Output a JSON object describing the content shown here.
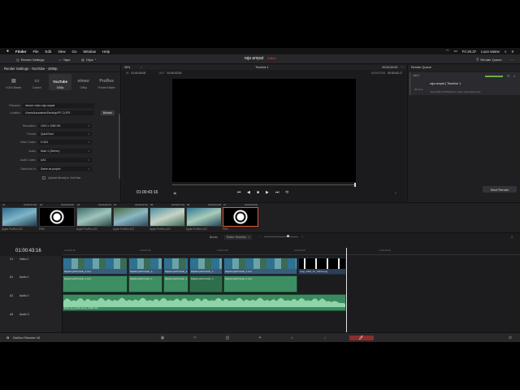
{
  "menubar": {
    "app": "Finder",
    "items": [
      "File",
      "Edit",
      "View",
      "Go",
      "Window",
      "Help"
    ],
    "clock": "Fri 20.37",
    "user": "Luca Vaime"
  },
  "toolbar": {
    "render_settings": "Render Settings",
    "tape": "Tape",
    "clips": "Clips",
    "project": "raja ampat",
    "edited": "Edited",
    "render_queue": "Render Queue"
  },
  "render_settings": {
    "header": "Render Settings - YouTube - 1080p",
    "presets": [
      {
        "logo": "▤",
        "label": "H.264 Master"
      },
      {
        "logo": "▭",
        "label": "Custom"
      },
      {
        "logo": "YouTube",
        "label": "1080p"
      },
      {
        "logo": "vimeo",
        "label": "1080p"
      },
      {
        "logo": "ProRes",
        "label": "Proxies Master"
      }
    ],
    "filename_label": "Filename",
    "filename": "dimore video raja ampat",
    "location_label": "Location",
    "location": "/Users/lucavaime/Desktop/FE CLIPS",
    "browse": "Browse",
    "resolution_label": "Resolution",
    "resolution": "1920 x 1080 HD",
    "format_label": "Format",
    "format": "QuickTime",
    "video_codec_label": "Video Codec",
    "video_codec": "H.264",
    "audio_label": "Audio",
    "audio": "Main 1 (Stereo)",
    "audio_codec_label": "Audio Codec",
    "audio_codec": "AAC",
    "data_burnin_label": "Data burn-in",
    "data_burnin": "Same as project",
    "upload_label": "Upload directly to YouTube",
    "add_queue": "Add to Render Queue"
  },
  "viewer": {
    "zoom": "39%",
    "timeline_name": "Timeline 1",
    "tc_top": "00:00:00:00",
    "in_label": "IN",
    "in_tc": "01:00:00:00",
    "out_label": "OUT",
    "out_tc": "01:00:43:16",
    "duration_label": "DURATION",
    "duration": "00:00:43:17",
    "current_tc": "01:00:43:16"
  },
  "render_queue": {
    "header": "Render Queue",
    "job_id": "Job 1",
    "job_title": "raja ampat | Timeline 1",
    "job_status": "09 Sorti",
    "job_path": "/Users/FE CLIPS/dimore video raja ampat.mov",
    "start_render": "Start Render"
  },
  "clips": [
    {
      "num": "01",
      "tc": "00:00:23:08",
      "codec": "Apple ProRes 422",
      "colors": [
        "#2e6c8f",
        "#7fb5c9",
        "#1d3d50"
      ]
    },
    {
      "num": "02",
      "tc": "00:00:00:00",
      "codec": "PNG",
      "colors": [
        "#000000",
        "#ffffff",
        "#000000"
      ]
    },
    {
      "num": "03",
      "tc": "00:00:09:23",
      "codec": "Apple ProRes 422",
      "colors": [
        "#3d6c6b",
        "#a0c4bb",
        "#2b4a4a"
      ]
    },
    {
      "num": "04",
      "tc": "00:00:10:12",
      "codec": "Apple ProRes 422",
      "colors": [
        "#4a6b3f",
        "#8bb7c4",
        "#2a4a5a"
      ]
    },
    {
      "num": "05",
      "tc": "00:00:07:23",
      "codec": "Apple ProRes 422",
      "colors": [
        "#4e8fa3",
        "#c7d3c6",
        "#3b6b55"
      ]
    },
    {
      "num": "06",
      "tc": "00:00:23:08",
      "codec": "Apple ProRes 422",
      "colors": [
        "#2f7a9a",
        "#a9cbb9",
        "#20495e"
      ]
    },
    {
      "num": "07",
      "tc": "00:00:00:00",
      "codec": "PNG",
      "colors": [
        "#000000",
        "#ffffff",
        "#000000"
      ]
    }
  ],
  "timeline": {
    "current_tc": "01:00:43:16",
    "bordo_label": "Bordo",
    "view_mode": "Entire Timeline",
    "tracks": [
      {
        "id": "V1",
        "name": "Video 1"
      },
      {
        "id": "A1",
        "name": "Audio 1"
      },
      {
        "id": "A2",
        "name": "Audio 2"
      },
      {
        "id": "A3",
        "name": "Audio 3"
      }
    ],
    "video_clips": [
      "RajaAmpatTornado_4.mov",
      "RajaAmpatTornado_1...",
      "RajaAmpatTornado_1...",
      "RajaAmpatTornado_1...",
      "RajaAmpatTornado_4.mov",
      "Logo_white_for_videos.png"
    ],
    "audio1_clips": [
      "RajaAmpatTornado_4.mov",
      "RajaAmpatTornado_1...",
      "RajaAmpatTornado_1...",
      "RajaAmpatTornado_1...",
      "RajaAmpatTornado_4.mov"
    ],
    "audio2_clip": "jarod_by_tomas-reuss_Artlist.wav"
  },
  "pagebar": {
    "app_name": "DaVinci Resolve 16",
    "pages": [
      "media-icon",
      "cut-icon",
      "edit-icon",
      "fusion-icon",
      "color-icon",
      "fairlight-icon",
      "deliver-icon"
    ]
  }
}
